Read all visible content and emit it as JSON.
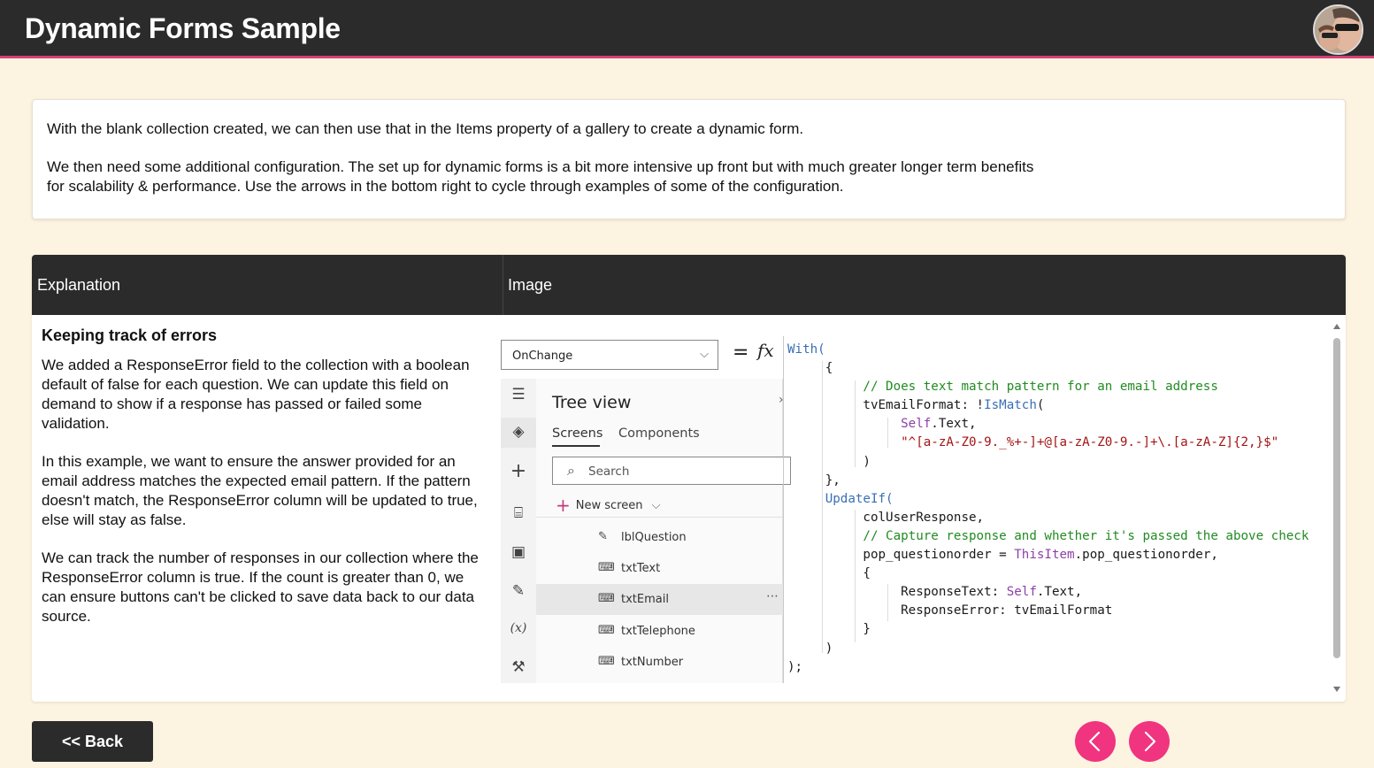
{
  "header": {
    "title": "Dynamic Forms Sample",
    "avatar_icon": "user-avatar-photo"
  },
  "intro": {
    "para1": "With the blank collection created, we can then use that in the Items property of a gallery to create a dynamic form.",
    "para2": "We then need some additional configuration. The set up for dynamic forms is a bit more intensive up front but with much greater longer term benefits for scalability & performance. Use the arrows in the bottom right to cycle through examples of some of the configuration."
  },
  "table": {
    "col_explanation": "Explanation",
    "col_image": "Image",
    "row": {
      "heading": "Keeping track of errors",
      "para1": "We added a ResponseError field to the collection with a boolean default of false for each question. We can update this field on demand to show if a response has passed or failed some validation.",
      "para2": "In this example, we want to ensure the answer provided for an email address matches the expected email pattern. If the pattern doesn't match, the ResponseError column will be updated to true, else will stay as false.",
      "para3": "We can track the number of responses in our collection where the ResponseError column is true. If the count is greater than 0, we can ensure buttons can't be clicked to save data back to our data source."
    }
  },
  "screenshot": {
    "property": "OnChange",
    "equals": "=",
    "fx": "fx",
    "tree_title": "Tree view",
    "tab_screens": "Screens",
    "tab_components": "Components",
    "search_placeholder": "Search",
    "new_screen": "New screen",
    "nodes": [
      "lblQuestion",
      "txtText",
      "txtEmail",
      "txtTelephone",
      "txtNumber"
    ],
    "code": {
      "l1": "With(",
      "l2": "{",
      "l3": "// Does text match pattern for an email address",
      "l4a": "tvEmailFormat: !",
      "l4b": "IsMatch",
      "l4c": "(",
      "l5a": "Self",
      "l5b": ".Text,",
      "l6": "\"^[a-zA-Z0-9._%+-]+@[a-zA-Z0-9.-]+\\.[a-zA-Z]{2,}$\"",
      "l7": ")",
      "l8": "},",
      "l9": "UpdateIf(",
      "l10": "colUserResponse,",
      "l11": "// Capture response and whether it's passed the above check",
      "l12a": "pop_questionorder = ",
      "l12b": "ThisItem",
      "l12c": ".pop_questionorder,",
      "l13": "{",
      "l14a": "ResponseText: ",
      "l14b": "Self",
      "l14c": ".Text,",
      "l15": "ResponseError: tvEmailFormat",
      "l16": "}",
      "l17": ")",
      "l18": ");"
    }
  },
  "footer": {
    "back_label": "<< Back",
    "prev_icon": "chevron-left-icon",
    "next_icon": "chevron-right-icon"
  },
  "colors": {
    "header_bg": "#2b2b2b",
    "accent_pink": "#f0347f",
    "page_bg": "#fdf3e1"
  }
}
